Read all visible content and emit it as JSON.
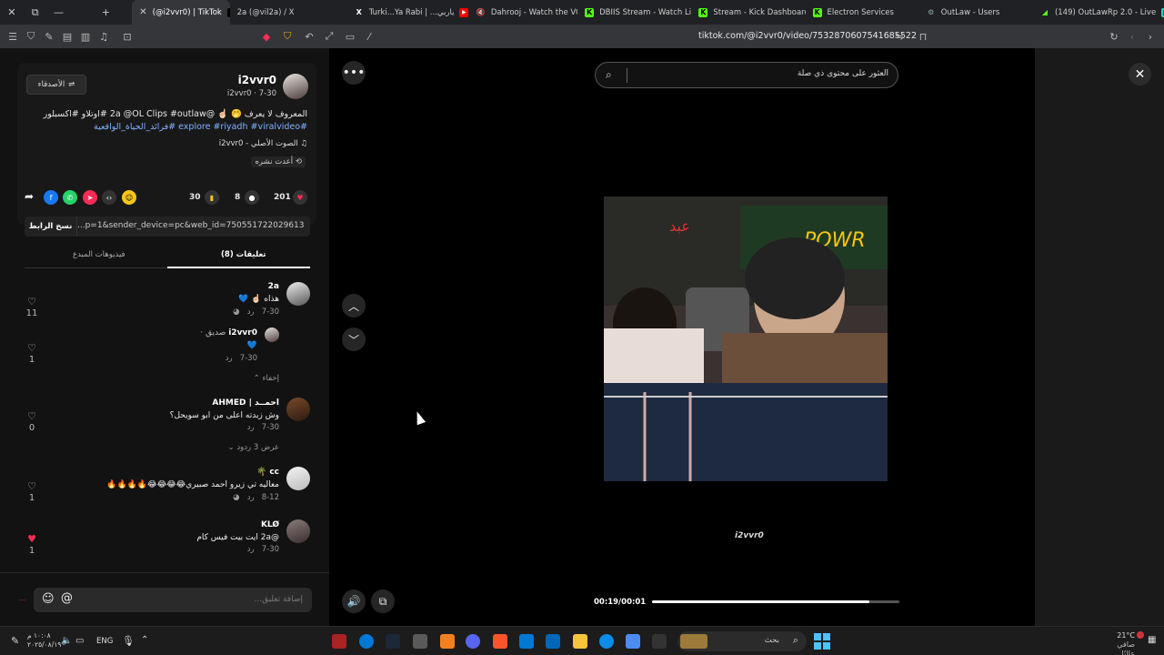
{
  "browser": {
    "tabs": [
      {
        "label": ""
      },
      {
        "label": ""
      },
      {
        "label": ""
      },
      {
        "label": "(@i2vvr0) | TikTok"
      },
      {
        "label": "2a (@vil2a) / X"
      },
      {
        "label": "Turki...Ya Rabi | ...ياربي"
      },
      {
        "label": "Dahrooj - Watch the VOD"
      },
      {
        "label": "DBIIS Stream - Watch Live"
      },
      {
        "label": "Stream - Kick Dashboard"
      },
      {
        "label": "Electron Services"
      },
      {
        "label": "OutLaw - Users"
      },
      {
        "label": "(149) OutLawRp 2.0 - Live"
      }
    ],
    "url": "tiktok.com/@i2vvr0/video/7532870607541685522"
  },
  "post": {
    "follow_label": "الأصدقاء",
    "username": "i2vvr0",
    "subline": "i2vvr0 · 7-30",
    "caption_line1": "المعروف لا يعرف 🤭 ☝🏻 @2a @OL Clips #outlaw #اوتلاو #اكسبلور",
    "caption_line2": "#explore #riyadh #viralvideo #فرائد_الحياة_الواقعية",
    "sound": "الصوت الأصلي - i2vvr0",
    "reposted": "أعدت نشره",
    "likes": "201",
    "comments": "8",
    "saves": "30",
    "link": "...p=1&sender_device=pc&web_id=7505517220296132151",
    "copy_link_label": "نسخ الرابط"
  },
  "tabs": {
    "comments_label": "تعليقات (8)",
    "creator_videos_label": "فيديوهات المبدع"
  },
  "comments": [
    {
      "name": "2a",
      "text": "هذاه ☝🏻 💙",
      "date": "7-30",
      "reply": "رد",
      "likes": "11"
    },
    {
      "name": "i2vvr0",
      "badge": "صديق ·",
      "text": "💙",
      "date": "7-30",
      "reply": "رد",
      "likes": "1"
    },
    {
      "hide_label": "إخفاء"
    },
    {
      "name": "احمــد | AHMED",
      "text": "وش زبدته اعلى من ابو سويحل؟",
      "date": "7-30",
      "reply": "رد",
      "likes": "0",
      "view_replies": "عرض 3 ردود"
    },
    {
      "name": "cc 🌴",
      "text": "معاليه تي زيرو احمد صبيري😂😂😂😂🔥🔥🔥🔥",
      "date": "8-12",
      "reply": "رد",
      "likes": "1"
    },
    {
      "name": "KLØ",
      "text": "@2a ايت بيت فيس كام",
      "date": "7-30",
      "reply": "رد",
      "likes": "1"
    }
  ],
  "input": {
    "placeholder": "إضافة تعليق..."
  },
  "player": {
    "search_placeholder": "العثور على محتوى ذي صلة",
    "time": "00:19/00:01",
    "progress": 0.88,
    "watermark": "i2vvr0"
  },
  "taskbar": {
    "search": "بحث",
    "lang": "ENG",
    "time": "١٠:٠٨ م",
    "date": "٢٠٢٥/٠٨/١٩",
    "weather_temp": "21°C",
    "weather_desc": "صافي عالبًا"
  },
  "colors": {
    "like_red": "#fe2c55",
    "link_blue": "#7fb3ff",
    "panel_bg": "#121212"
  }
}
